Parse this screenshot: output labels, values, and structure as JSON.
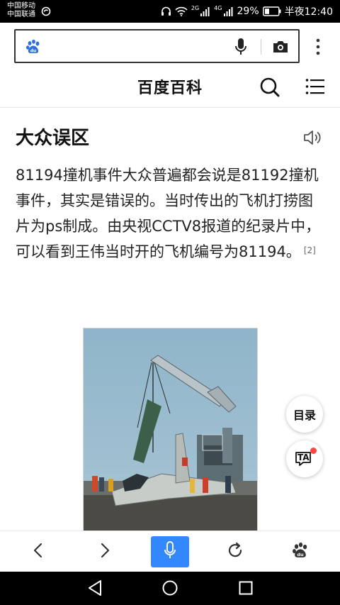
{
  "status_bar": {
    "carrier_1": "中国移动",
    "carrier_2": "中国联通",
    "network_1": "2G",
    "network_2": "4G",
    "battery": "29%",
    "time": "半夜12:40"
  },
  "browser": {
    "search_value": "",
    "icons": [
      "baidu-paw-icon",
      "microphone-icon",
      "camera-icon",
      "more-vertical-icon"
    ]
  },
  "header": {
    "title": "百度百科",
    "icons": [
      "search-icon",
      "menu-icon"
    ]
  },
  "article": {
    "section_title": "大众误区",
    "paragraph": "81194撞机事件大众普遍都会说是81192撞机事件，其实是错误的。当时传出的飞机打捞图片为ps制成。由央视CCTV8报道的纪录片中，可以看到王伟当时开的飞机编号为81194。",
    "citation": "[2]"
  },
  "floating": {
    "toc_label": "目录",
    "read_label": "TA"
  },
  "toolbar": {
    "icons": [
      "back-icon",
      "forward-icon",
      "microphone-icon",
      "refresh-icon",
      "baidu-paw-icon"
    ]
  },
  "colors": {
    "accent": "#3388ff",
    "status_bar": "#000000",
    "badge": "#ff4444"
  }
}
